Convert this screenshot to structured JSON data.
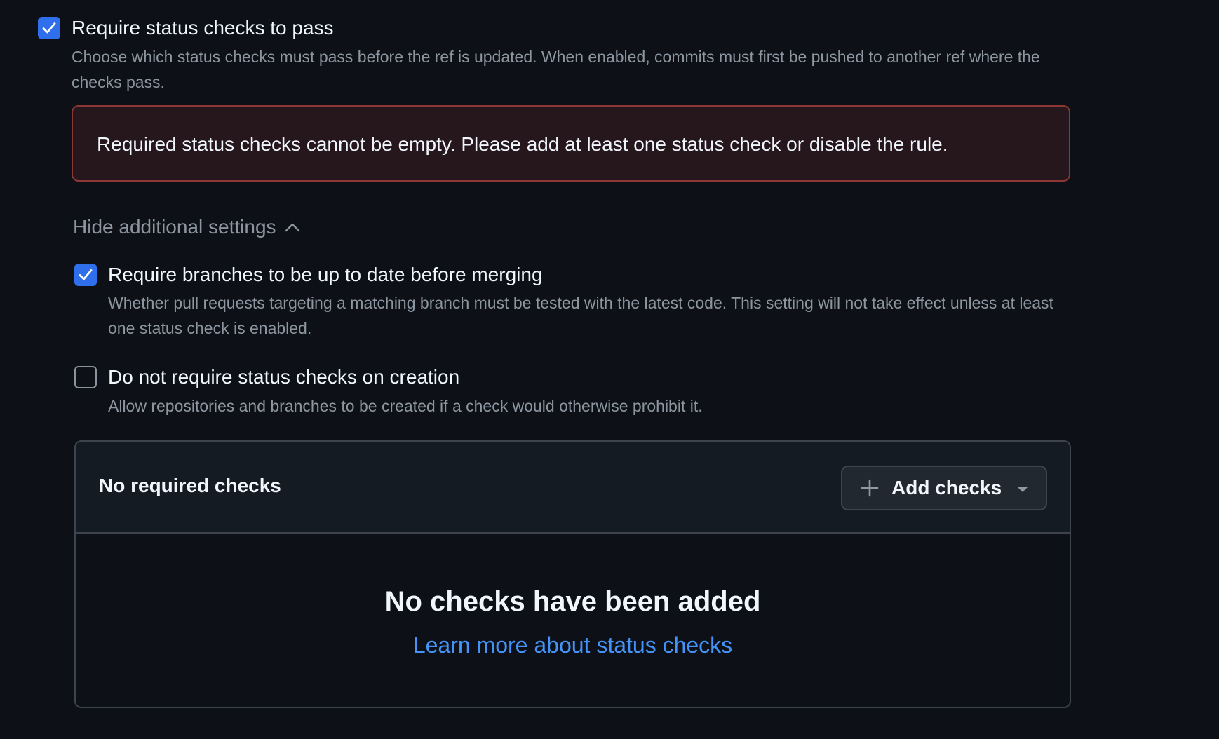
{
  "status_checks_rule": {
    "label": "Require status checks to pass",
    "checked": true,
    "description": "Choose which status checks must pass before the ref is updated. When enabled, commits must first be pushed to another ref where the checks pass."
  },
  "error": {
    "message": "Required status checks cannot be empty. Please add at least one status check or disable the rule."
  },
  "additional_settings": {
    "toggle_label": "Hide additional settings",
    "toggle_icon": "chevron-up-icon",
    "options": [
      {
        "label": "Require branches to be up to date before merging",
        "checked": true,
        "description": "Whether pull requests targeting a matching branch must be tested with the latest code. This setting will not take effect unless at least one status check is enabled."
      },
      {
        "label": "Do not require status checks on creation",
        "checked": false,
        "description": "Allow repositories and branches to be created if a check would otherwise prohibit it."
      }
    ]
  },
  "checks_panel": {
    "title": "No required checks",
    "add_button_label": "Add checks",
    "add_button_icons": [
      "plus-icon",
      "triangle-down-icon"
    ],
    "empty_title": "No checks have been added",
    "learn_more_link": "Learn more about status checks"
  },
  "colors": {
    "background": "#0d1117",
    "accent": "#2f6feb",
    "link": "#4493f8",
    "error_border": "#8e3633",
    "error_background": "#25171c"
  }
}
